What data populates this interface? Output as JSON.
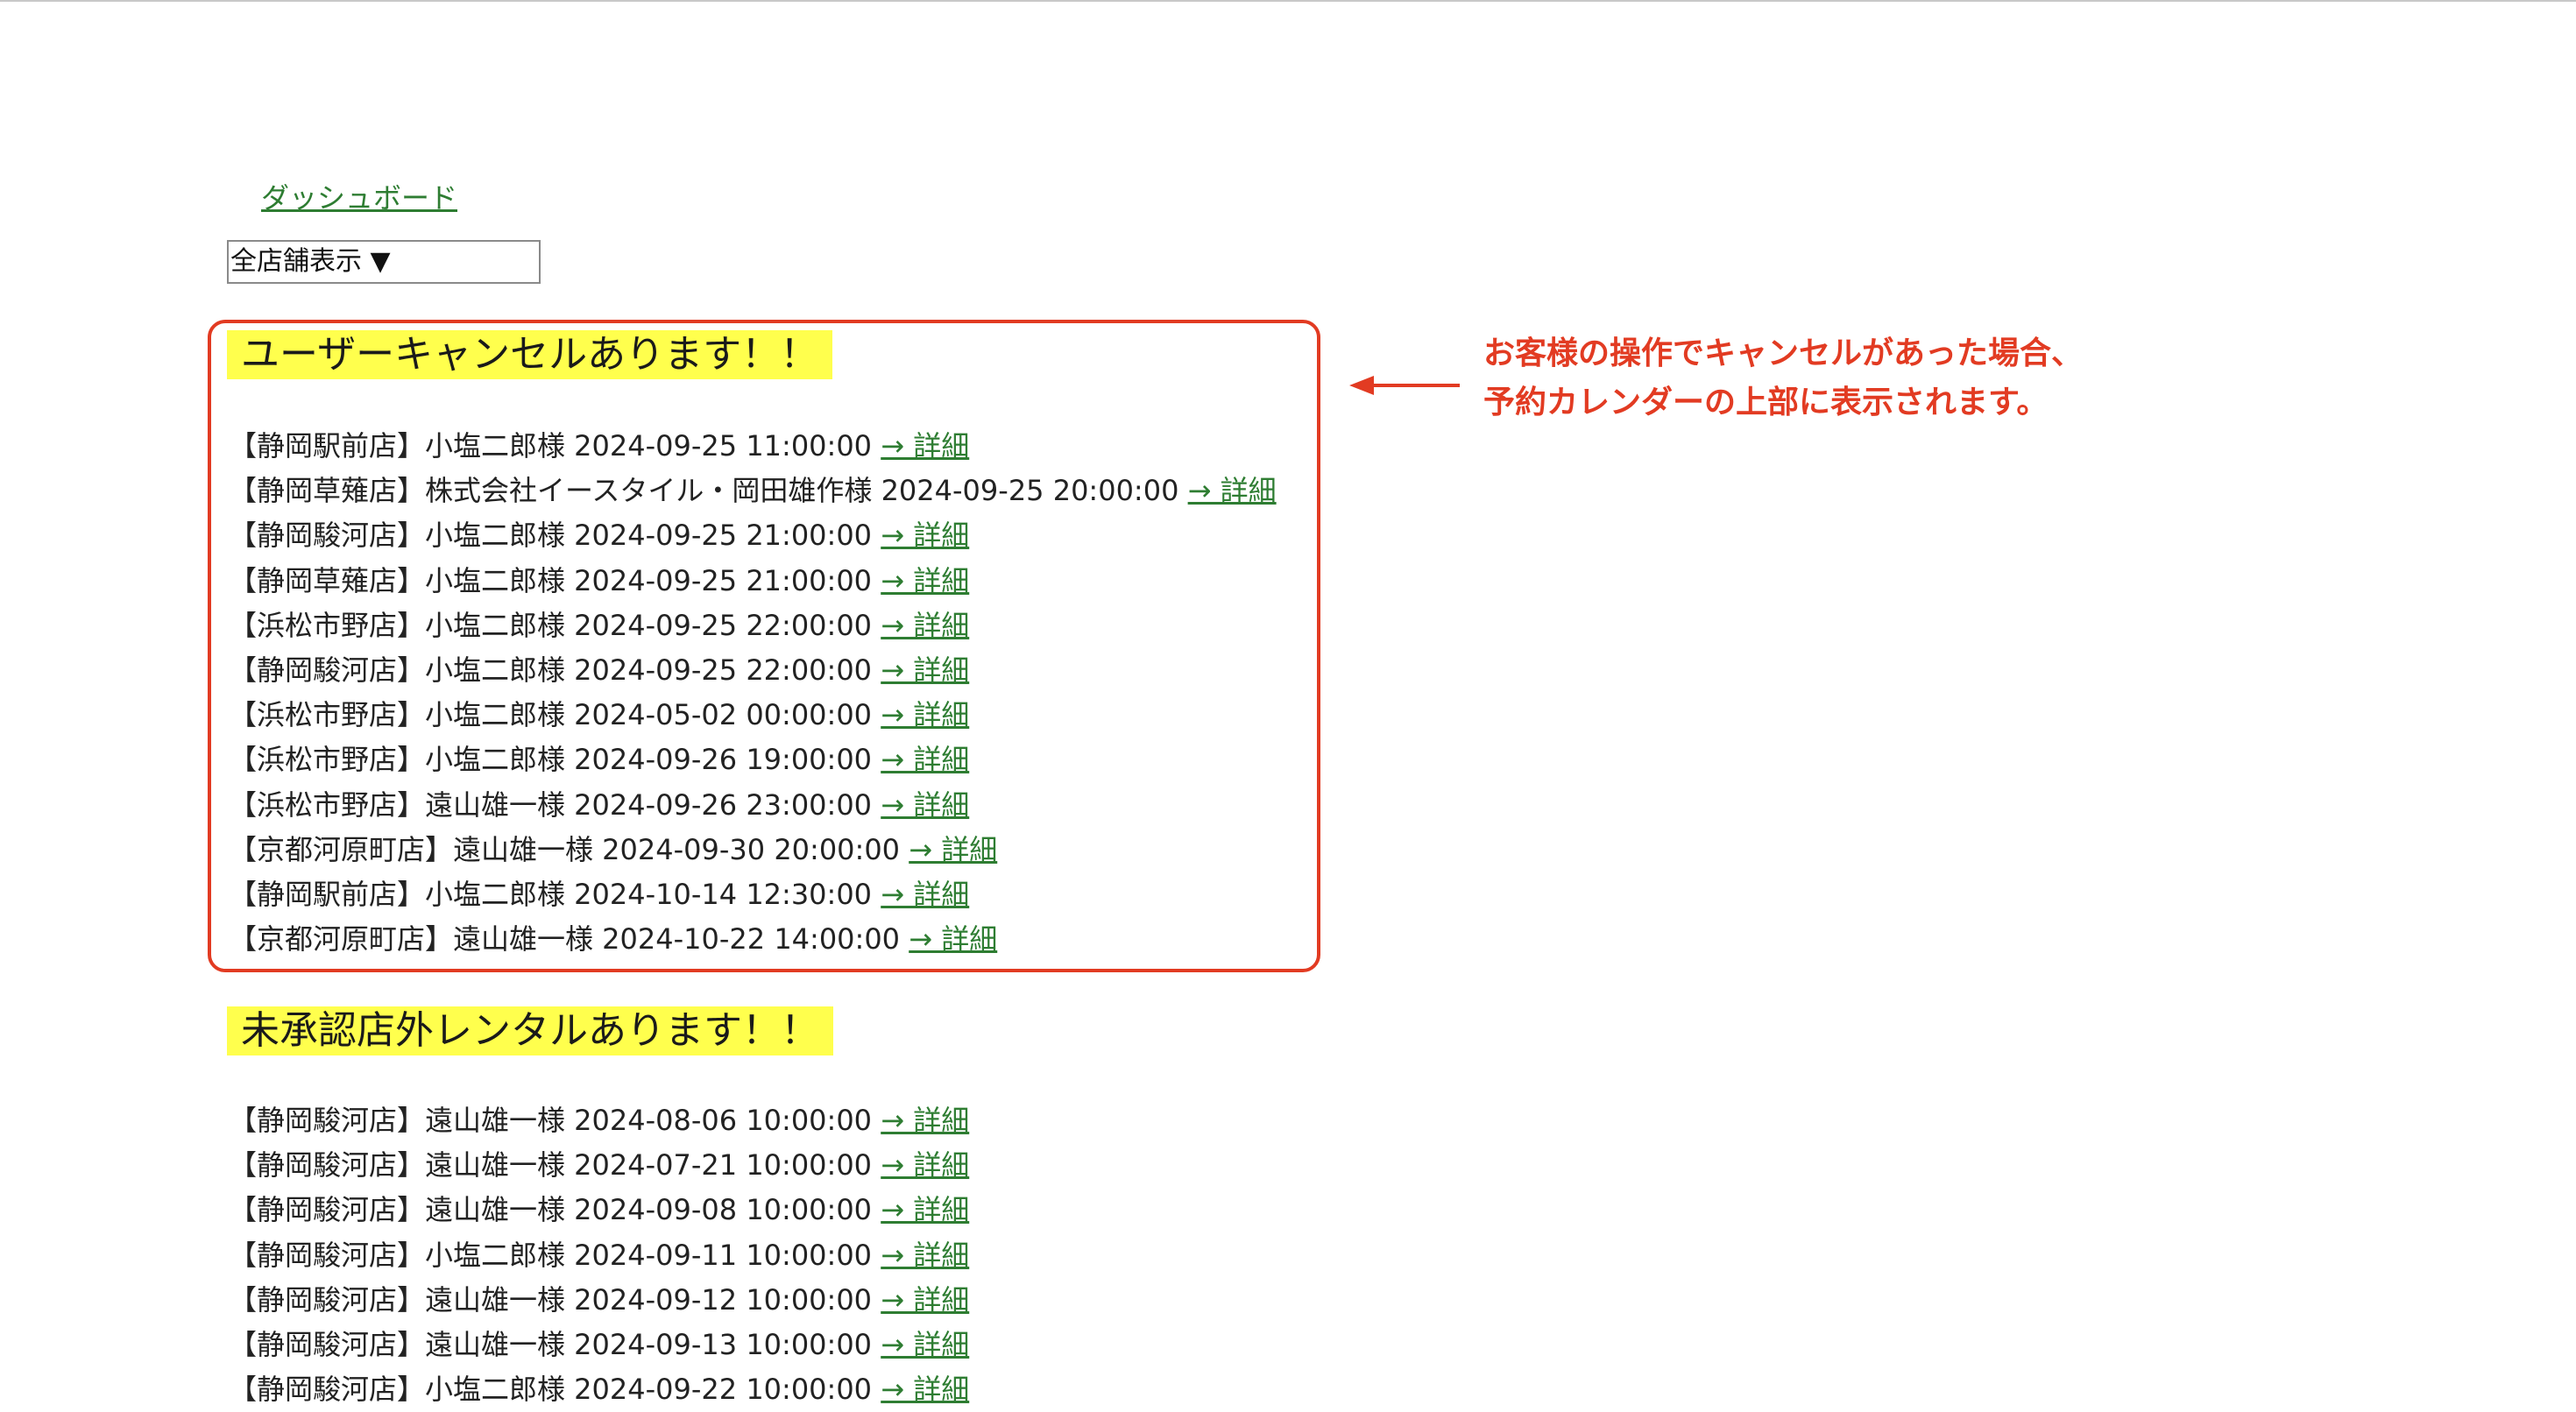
{
  "nav": {
    "dashboard_link": "ダッシュボード"
  },
  "store_filter": {
    "selected": "全店舗表示 ▼"
  },
  "cancellations": {
    "heading": "ユーザーキャンセルあります！！",
    "items": [
      {
        "text": "【静岡駅前店】小塩二郎様 2024-09-25 11:00:00 ",
        "link": "→ 詳細"
      },
      {
        "text": "【静岡草薙店】株式会社イースタイル・岡田雄作様 2024-09-25 20:00:00 ",
        "link": "→ 詳細"
      },
      {
        "text": "【静岡駿河店】小塩二郎様 2024-09-25 21:00:00 ",
        "link": "→ 詳細"
      },
      {
        "text": "【静岡草薙店】小塩二郎様 2024-09-25 21:00:00 ",
        "link": "→ 詳細"
      },
      {
        "text": "【浜松市野店】小塩二郎様 2024-09-25 22:00:00 ",
        "link": "→ 詳細"
      },
      {
        "text": "【静岡駿河店】小塩二郎様 2024-09-25 22:00:00 ",
        "link": "→ 詳細"
      },
      {
        "text": "【浜松市野店】小塩二郎様 2024-05-02 00:00:00 ",
        "link": "→ 詳細"
      },
      {
        "text": "【浜松市野店】小塩二郎様 2024-09-26 19:00:00 ",
        "link": "→ 詳細"
      },
      {
        "text": "【浜松市野店】遠山雄一様 2024-09-26 23:00:00 ",
        "link": "→ 詳細"
      },
      {
        "text": "【京都河原町店】遠山雄一様 2024-09-30 20:00:00 ",
        "link": "→ 詳細"
      },
      {
        "text": "【静岡駅前店】小塩二郎様 2024-10-14 12:30:00 ",
        "link": "→ 詳細"
      },
      {
        "text": "【京都河原町店】遠山雄一様 2024-10-22 14:00:00 ",
        "link": "→ 詳細"
      }
    ]
  },
  "unapproved_rentals": {
    "heading": "未承認店外レンタルあります！！",
    "items": [
      {
        "text": "【静岡駿河店】遠山雄一様 2024-08-06 10:00:00 ",
        "link": "→ 詳細"
      },
      {
        "text": "【静岡駿河店】遠山雄一様 2024-07-21 10:00:00 ",
        "link": "→ 詳細"
      },
      {
        "text": "【静岡駿河店】遠山雄一様 2024-09-08 10:00:00 ",
        "link": "→ 詳細"
      },
      {
        "text": "【静岡駿河店】小塩二郎様 2024-09-11 10:00:00 ",
        "link": "→ 詳細"
      },
      {
        "text": "【静岡駿河店】遠山雄一様 2024-09-12 10:00:00 ",
        "link": "→ 詳細"
      },
      {
        "text": "【静岡駿河店】遠山雄一様 2024-09-13 10:00:00 ",
        "link": "→ 詳細"
      },
      {
        "text": "【静岡駿河店】小塩二郎様 2024-09-22 10:00:00 ",
        "link": "→ 詳細"
      }
    ]
  },
  "annotation": {
    "line1": "お客様の操作でキャンセルがあった場合、",
    "line2": "予約カレンダーの上部に表示されます。",
    "color": "#e23b22"
  },
  "colors": {
    "link": "#2e7d32",
    "heading_highlight": "#ffff4d",
    "callout_border": "#e23b22"
  }
}
